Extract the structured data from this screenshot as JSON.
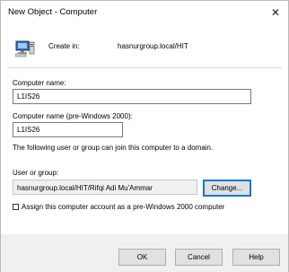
{
  "window": {
    "title": "New Object - Computer",
    "close_glyph": "✕"
  },
  "header": {
    "icon": "computer-icon",
    "create_in_label": "Create in:",
    "create_in_value": "hasnurgroup.local/HIT"
  },
  "form": {
    "computer_name_label": "Computer name:",
    "computer_name_value": "L1IS26",
    "pre2000_label": "Computer name (pre-Windows 2000):",
    "pre2000_value": "L1IS26",
    "join_info": "The following user or group can join this computer to a domain.",
    "user_group_label": "User or group:",
    "user_group_value": "hasnurgroup.local/HIT/Rifqi Adi Mu'Ammar",
    "change_button": "Change...",
    "assign_checkbox_label": "Assign this computer account as a pre-Windows 2000 computer",
    "assign_checked": false
  },
  "footer": {
    "ok_button": "OK",
    "cancel_button": "Cancel",
    "help_button": "Help"
  }
}
